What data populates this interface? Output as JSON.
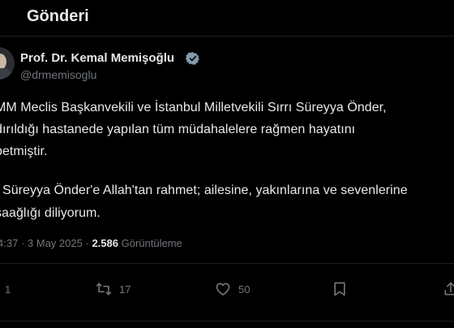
{
  "header": {
    "title": "Gönderi"
  },
  "author": {
    "name": "Prof. Dr. Kemal Memişoğlu",
    "handle": "@drmemisoglu"
  },
  "tweet": {
    "lines": [
      "MM Meclis Başkanvekili ve İstanbul Milletvekili Sırrı Süreyya Önder,",
      "dırıldığı hastanede yapılan tüm müdahalelere rağmen hayatını",
      "betmiştir.",
      "ı Süreyya Önder'e Allah'tan rahmet; ailesine, yakınlarına ve sevenlerine",
      "saağlığı diliyorum."
    ]
  },
  "meta": {
    "time": "4:37",
    "separator": "·",
    "date": "3 May 2025",
    "views": "2.586",
    "views_label": "Görüntüleme"
  },
  "actions": {
    "reply_count": "1",
    "retweet_count": "17",
    "like_count": "50"
  },
  "colors": {
    "background": "#000000",
    "text": "#e7e9ea",
    "secondary": "#71767b",
    "verified": "#829aab"
  }
}
